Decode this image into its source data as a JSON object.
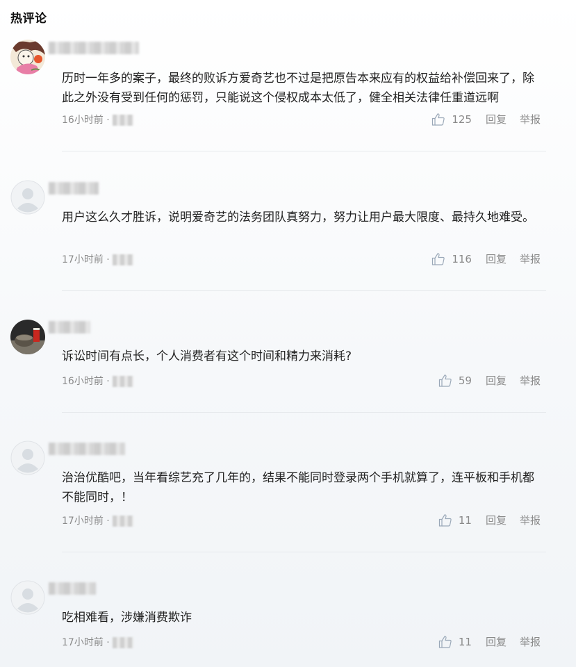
{
  "section": {
    "title": "热评论"
  },
  "comments": [
    {
      "content": "历时一年多的案子，最终的败诉方爱奇艺也不过是把原告本来应有的权益给补偿回来了，除此之外没有受到任何的惩罚，只能说这个侵权成本太低了，健全相关法律任重道远啊",
      "time": "16小时前 ·",
      "likes": "125",
      "reply_label": "回复",
      "report_label": "举报",
      "avatar_icon": "drawn-avatar-icon"
    },
    {
      "content": "用户这么久才胜诉，说明爱奇艺的法务团队真努力，努力让用户最大限度、最持久地难受。",
      "time": "17小时前 ·",
      "likes": "116",
      "reply_label": "回复",
      "report_label": "举报",
      "avatar_icon": "default-avatar-icon"
    },
    {
      "content": "诉讼时间有点长，个人消费者有这个时间和精力来消耗?",
      "time": "16小时前 ·",
      "likes": "59",
      "reply_label": "回复",
      "report_label": "举报",
      "avatar_icon": "photo-avatar-icon"
    },
    {
      "content": "治治优酷吧，当年看综艺充了几年的，结果不能同时登录两个手机就算了，连平板和手机都不能同时，！",
      "time": "17小时前 ·",
      "likes": "11",
      "reply_label": "回复",
      "report_label": "举报",
      "avatar_icon": "default-avatar-icon"
    },
    {
      "content": "吃相难看，涉嫌消费欺诈",
      "time": "17小时前 ·",
      "likes": "11",
      "reply_label": "回复",
      "report_label": "举报",
      "avatar_icon": "default-avatar-icon"
    }
  ],
  "colors": {
    "text": "#222222",
    "meta": "#8a8a8a",
    "divider": "#e6e9ec"
  }
}
